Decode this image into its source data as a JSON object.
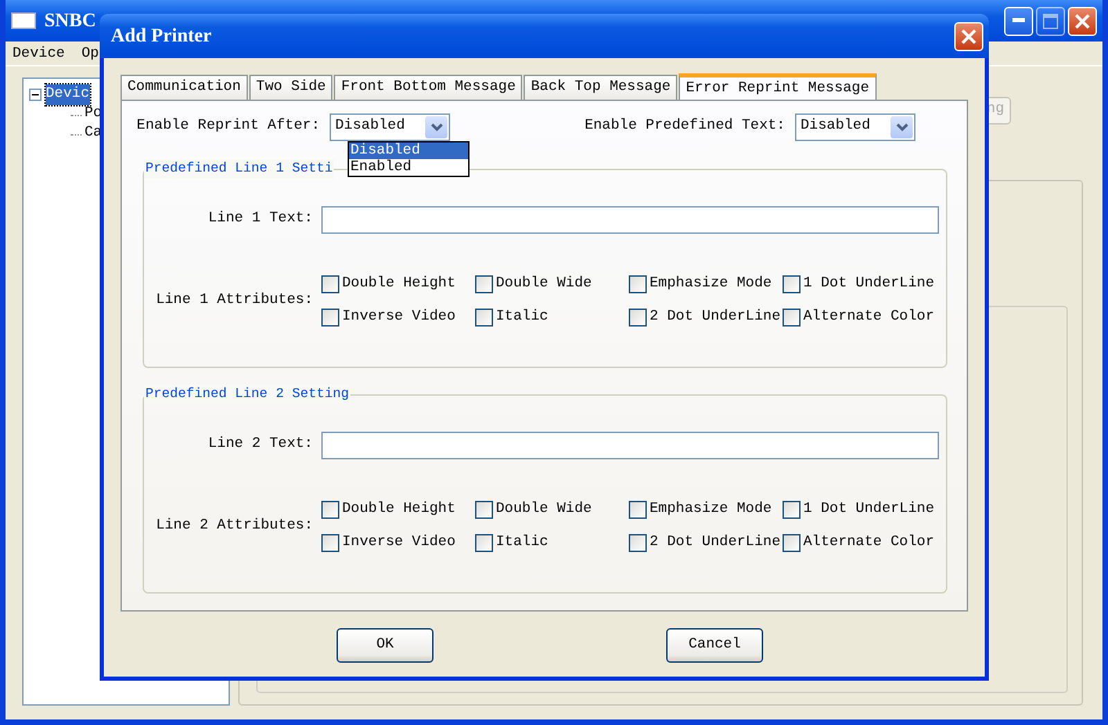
{
  "app": {
    "title": "SNBC",
    "menu": [
      "Device",
      "Op"
    ],
    "tree": [
      {
        "label": "Devic",
        "expanded": true,
        "selected": true,
        "children": [
          {
            "label": "Po"
          },
          {
            "label": "Ca"
          }
        ]
      }
    ],
    "background_button": "ng"
  },
  "dialog": {
    "title": "Add Printer",
    "tabs": [
      {
        "label": "Communication",
        "selected": false
      },
      {
        "label": "Two Side",
        "selected": false
      },
      {
        "label": "Front Bottom Message",
        "selected": false
      },
      {
        "label": "Back Top Message",
        "selected": false
      },
      {
        "label": "Error Reprint Message",
        "selected": true
      }
    ],
    "reprint_after": {
      "label": "Enable Reprint After:",
      "value": "Disabled",
      "open": true,
      "options": [
        {
          "label": "Disabled",
          "selected": true
        },
        {
          "label": "Enabled",
          "selected": false
        }
      ]
    },
    "predefined_text": {
      "label": "Enable Predefined Text:",
      "value": "Disabled"
    },
    "groups": [
      {
        "title": "Predefined Line 1 Setti",
        "text_label": "Line 1 Text:",
        "attributes_label": "Line 1 Attributes:",
        "attributes": [
          {
            "label": "Double Height",
            "checked": false
          },
          {
            "label": "Double Wide",
            "checked": false
          },
          {
            "label": "Emphasize Mode",
            "checked": false
          },
          {
            "label": "1 Dot UnderLine",
            "checked": false
          },
          {
            "label": "Inverse Video",
            "checked": false
          },
          {
            "label": "Italic",
            "checked": false
          },
          {
            "label": "2 Dot UnderLine",
            "checked": false
          },
          {
            "label": "Alternate Color",
            "checked": false
          }
        ]
      },
      {
        "title": "Predefined Line 2 Setting",
        "text_label": "Line 2 Text:",
        "attributes_label": "Line 2 Attributes:",
        "attributes": [
          {
            "label": "Double Height",
            "checked": false
          },
          {
            "label": "Double Wide",
            "checked": false
          },
          {
            "label": "Emphasize Mode",
            "checked": false
          },
          {
            "label": "1 Dot UnderLine",
            "checked": false
          },
          {
            "label": "Inverse Video",
            "checked": false
          },
          {
            "label": "Italic",
            "checked": false
          },
          {
            "label": "2 Dot UnderLine",
            "checked": false
          },
          {
            "label": "Alternate Color",
            "checked": false
          }
        ]
      }
    ],
    "buttons": [
      "OK",
      "Cancel"
    ]
  }
}
